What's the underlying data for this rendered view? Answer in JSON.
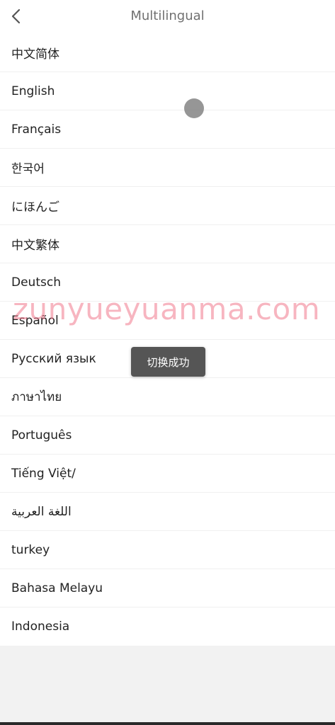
{
  "header": {
    "title": "Multilingual",
    "back_icon": "chevron-left-icon"
  },
  "languages": [
    "中文简体",
    "English",
    "Français",
    "한국어",
    "にほんご",
    "中文繁体",
    "Deutsch",
    "Español",
    "Русский язык",
    "ภาษาไทย",
    "Português",
    "Tiếng Việt/",
    "اللغة العربية",
    "turkey",
    "Bahasa Melayu",
    "Indonesia"
  ],
  "toast": {
    "message": "切换成功"
  },
  "watermark": {
    "text": "zunyueyuanma.com"
  },
  "colors": {
    "title_text": "#707070",
    "item_text": "#222222",
    "background": "#f2f2f2",
    "toast_bg": "#555555",
    "watermark": "#f0788c"
  }
}
